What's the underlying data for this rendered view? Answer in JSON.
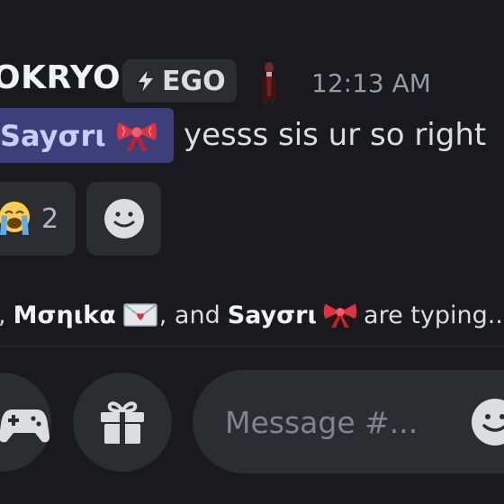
{
  "message": {
    "author": "OKRYO",
    "tag": "EGO",
    "tag_icon": "lightning-icon",
    "timestamp": "12:13 AM",
    "mention": "Sayσrι",
    "mention_emoji": "ribbon-icon",
    "text": "yesss sis ur so right"
  },
  "reactions": [
    {
      "emoji": "loudly-crying-face-icon",
      "count": "2"
    }
  ],
  "add_reaction_icon": "smiley-add-reaction-icon",
  "typing": {
    "lead": ",",
    "user1": "Mσηιkα",
    "user1_emoji": "love-letter-icon",
    "middle": ", and",
    "user2": "Sayσrι",
    "user2_emoji": "ribbon-icon",
    "suffix": "are typing..."
  },
  "composer": {
    "placeholder": "Message #...",
    "games_icon": "gamepad-icon",
    "gift_icon": "gift-icon",
    "emoji_icon": "emoji-picker-icon"
  },
  "colors": {
    "background": "#1a1a1e",
    "surface": "#2b2d31",
    "mention_bg": "#3c3f7a",
    "mention_text": "#c9cdfb",
    "muted": "#949ba4"
  }
}
